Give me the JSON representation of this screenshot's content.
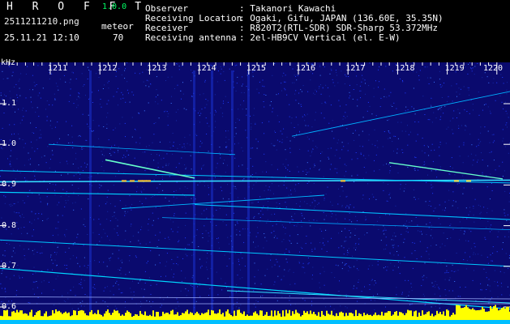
{
  "app": {
    "title": "H R O F F T",
    "version": "1.0.0"
  },
  "file_name": "2511211210.png",
  "datetime": "25.11.21 12:10",
  "meteor": {
    "label": "meteor",
    "count": "70"
  },
  "info": {
    "observer_label": "Observer",
    "observer_value": ": Takanori Kawachi",
    "location_label": "Receiving Location",
    "location_value": ": Ogaki, Gifu, JAPAN (136.60E, 35.35N)",
    "receiver_label": "Receiver",
    "receiver_value": ": R820T2(RTL-SDR) SDR-Sharp 53.372MHz",
    "antenna_label": "Receiving antenna",
    "antenna_value": ": 2el-HB9CV Vertical (el. E-W)"
  },
  "axis": {
    "unit": "kHz",
    "y_ticks": [
      "1.1",
      "1.0",
      "0.9",
      "0.8",
      "0.7",
      "0.6"
    ],
    "time_ticks": [
      "1211",
      "1212",
      "1213",
      "1214",
      "1215",
      "1216",
      "1217",
      "1218",
      "1219",
      "1220"
    ]
  },
  "colors": {
    "background": "#0a0a6e",
    "noise": "#1e3cff",
    "trace": "#00e5ff",
    "signal": "#ffff00"
  }
}
